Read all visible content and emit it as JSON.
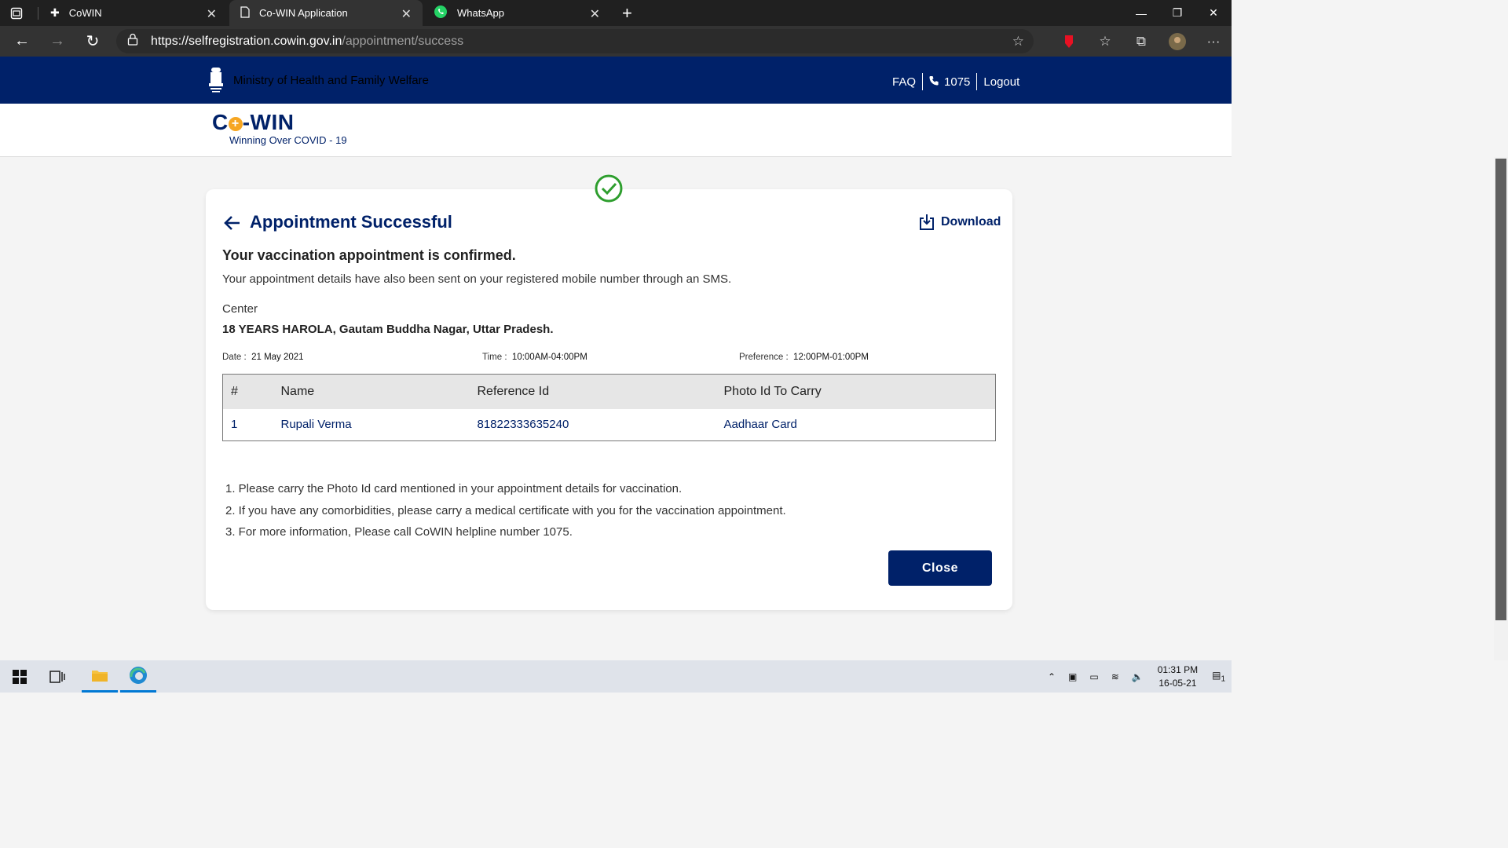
{
  "browser": {
    "tabs": [
      {
        "label": "CoWIN",
        "icon": "cowin-icon",
        "active": false
      },
      {
        "label": "Co-WIN Application",
        "icon": "page-icon",
        "active": true
      },
      {
        "label": "WhatsApp",
        "icon": "whatsapp-icon",
        "active": false
      }
    ],
    "url_host": "https://selfregistration.cowin.gov.in",
    "url_path": "/appointment/success"
  },
  "header": {
    "ministry": "Ministry of Health and Family Welfare",
    "faq": "FAQ",
    "helpline": "1075",
    "logout": "Logout",
    "brand_color": "#002169"
  },
  "brand": {
    "logo_co": "C",
    "logo_win": "-WIN",
    "tagline": "Winning Over COVID - 19"
  },
  "card": {
    "title": "Appointment Successful",
    "download_label": "Download",
    "confirm_heading": "Your vaccination appointment is confirmed.",
    "sms_note": "Your appointment details have also been sent on your registered mobile number through an SMS.",
    "center_label": "Center",
    "center_value": "18 YEARS HAROLA, Gautam Buddha Nagar, Uttar Pradesh.",
    "date_label": "Date :",
    "date_value": "21 May 2021",
    "time_label": "Time :",
    "time_value": "10:00AM-04:00PM",
    "preference_label": "Preference :",
    "preference_value": "12:00PM-01:00PM",
    "success_color": "#2e9e2e"
  },
  "table": {
    "headers": [
      "#",
      "Name",
      "Reference Id",
      "Photo Id To Carry"
    ],
    "rows": [
      [
        "1",
        "Rupali Verma",
        "81822333635240",
        "Aadhaar Card"
      ]
    ]
  },
  "instructions": [
    "1.  Please carry the Photo Id card mentioned in your appointment details for vaccination.",
    "2.  If you have any comorbidities, please carry a medical certificate with you for the vaccination appointment.",
    "3.  For more information, Please call CoWIN helpline number 1075."
  ],
  "close_label": "Close",
  "taskbar": {
    "time": "01:31 PM",
    "date": "16-05-21",
    "notification_count": "1"
  }
}
